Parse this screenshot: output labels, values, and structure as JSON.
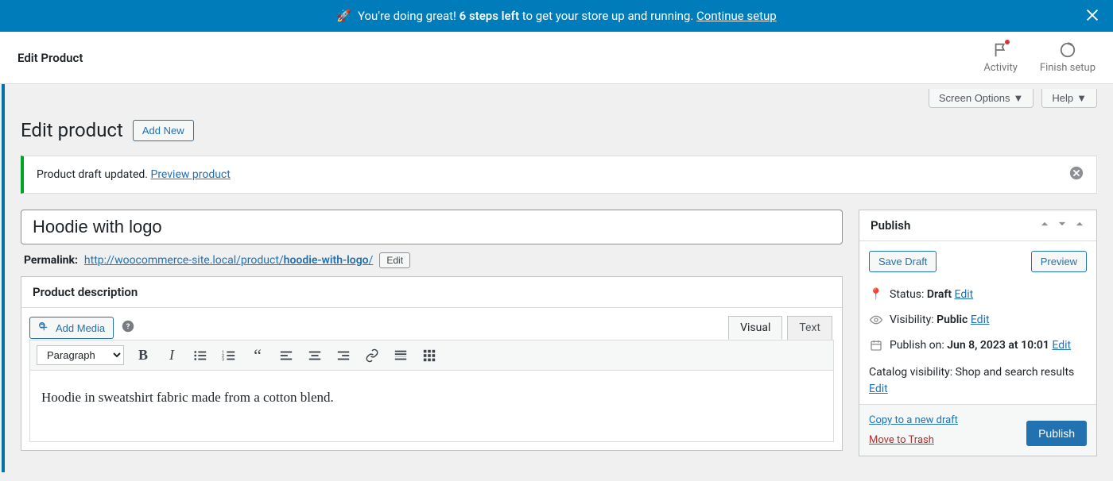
{
  "banner": {
    "prefix": "You're doing great! ",
    "bold": "6 steps left",
    "suffix": " to get your store up and running. ",
    "link": "Continue setup"
  },
  "header": {
    "title": "Edit Product",
    "activity": "Activity",
    "finish_setup": "Finish setup"
  },
  "screen": {
    "options": "Screen Options",
    "help": "Help"
  },
  "page": {
    "heading": "Edit product",
    "add_new": "Add New"
  },
  "notice": {
    "text": "Product draft updated. ",
    "link": "Preview product"
  },
  "product": {
    "title": "Hoodie with logo"
  },
  "permalink": {
    "label": "Permalink:",
    "base": "http://woocommerce-site.local/product/",
    "slug": "hoodie-with-logo",
    "trail": "/",
    "edit": "Edit"
  },
  "description": {
    "title": "Product description",
    "add_media": "Add Media",
    "tab_visual": "Visual",
    "tab_text": "Text",
    "format": "Paragraph",
    "content": "Hoodie in sweatshirt fabric made from a cotton blend."
  },
  "publish": {
    "title": "Publish",
    "save_draft": "Save Draft",
    "preview": "Preview",
    "status_label": "Status:",
    "status_value": "Draft",
    "visibility_label": "Visibility:",
    "visibility_value": "Public",
    "publish_on_label": "Publish on:",
    "publish_on_value": "Jun 8, 2023 at 10:01",
    "catalog_label": "Catalog visibility: ",
    "catalog_value": "Shop and search results",
    "edit": "Edit",
    "copy": "Copy to a new draft",
    "trash": "Move to Trash",
    "publish_btn": "Publish"
  }
}
